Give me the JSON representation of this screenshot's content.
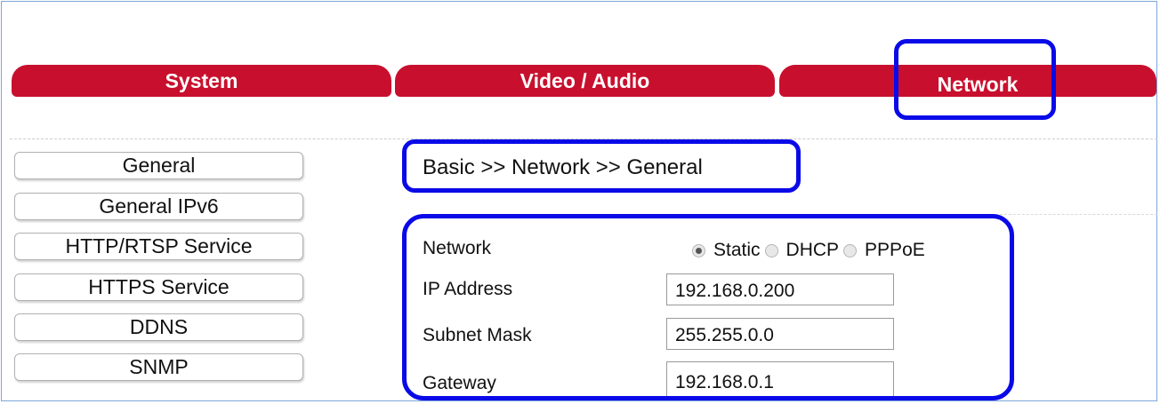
{
  "tabs": [
    {
      "label": "System"
    },
    {
      "label": "Video / Audio"
    },
    {
      "label": "Network"
    }
  ],
  "sidebar": {
    "items": [
      {
        "label": "General"
      },
      {
        "label": "General IPv6"
      },
      {
        "label": "HTTP/RTSP Service"
      },
      {
        "label": "HTTPS Service"
      },
      {
        "label": "DDNS"
      },
      {
        "label": "SNMP"
      }
    ]
  },
  "breadcrumb": "Basic >> Network >> General",
  "form": {
    "network_label": "Network",
    "network_mode": {
      "options": [
        "Static",
        "DHCP",
        "PPPoE"
      ],
      "selected": "Static"
    },
    "ip_label": "IP Address",
    "ip_value": "192.168.0.200",
    "subnet_label": "Subnet Mask",
    "subnet_value": "255.255.0.0",
    "gateway_label": "Gateway",
    "gateway_value": "192.168.0.1"
  },
  "colors": {
    "tab_red": "#c8102e",
    "highlight_blue": "#0a0ae8"
  }
}
